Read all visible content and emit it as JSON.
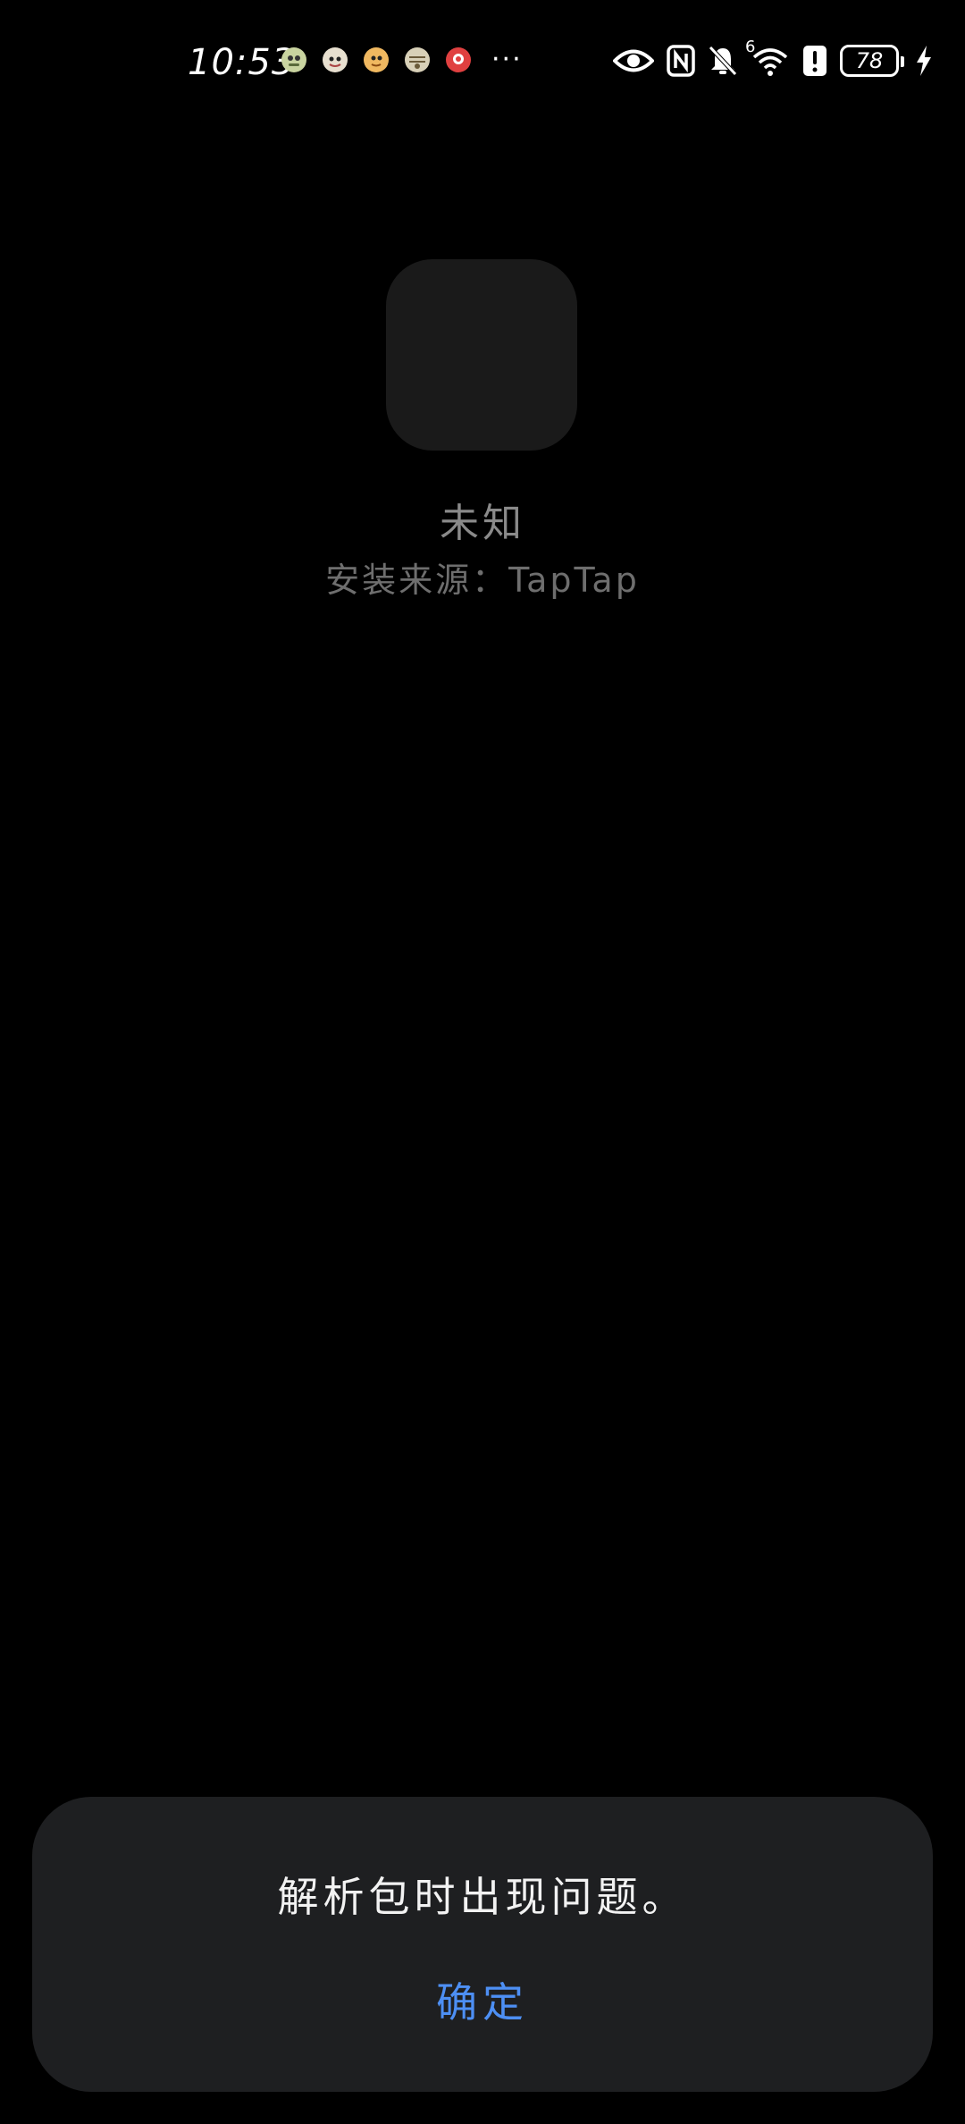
{
  "status_bar": {
    "time": "10:53",
    "more_indicator": "···",
    "notification_icons": [
      {
        "icon": "app-notification-icon-1",
        "color": "#c9d4a0"
      },
      {
        "icon": "app-notification-icon-2",
        "color": "#e8e0d0"
      },
      {
        "icon": "app-notification-icon-3",
        "color": "#f0b860"
      },
      {
        "icon": "app-notification-icon-4",
        "color": "#d8d0b8"
      },
      {
        "icon": "app-notification-icon-5",
        "color": "#e04040"
      }
    ],
    "system_icons": [
      "eye-icon",
      "nfc-icon",
      "bell-muted-icon",
      "wifi-6-icon",
      "alert-icon",
      "battery-icon",
      "charging-icon"
    ],
    "wifi_label": "6",
    "battery_level": "78"
  },
  "app": {
    "name": "未知",
    "install_source": "安装来源：TapTap",
    "icon_color": "#1a1a1a"
  },
  "dialog": {
    "message": "解析包时出现问题。",
    "confirm_label": "确定",
    "accent_color": "#4d8ff4",
    "background_color": "#1e1f21"
  }
}
